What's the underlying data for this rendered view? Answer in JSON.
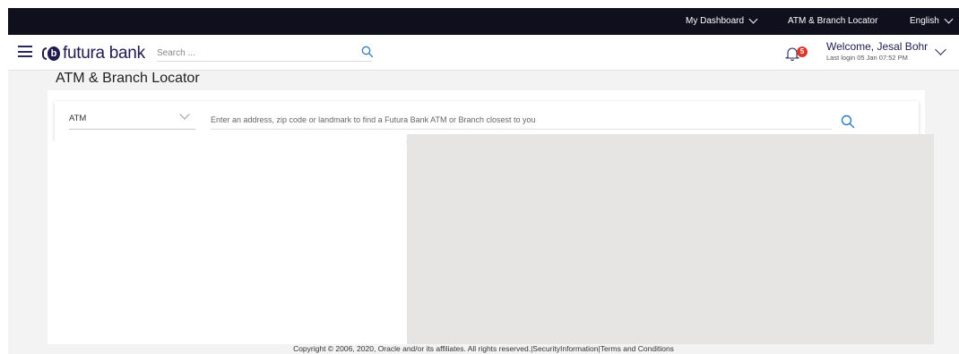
{
  "topbar": {
    "dashboard": "My Dashboard",
    "atm_branch": "ATM & Branch Locator",
    "language": "English"
  },
  "header": {
    "brand": "futura bank",
    "logo_letter": "b",
    "search_placeholder": "Search ...",
    "notification_count": "5",
    "welcome": "Welcome, Jesal Bohr",
    "last_login": "Last login 05 Jan 07:52 PM"
  },
  "page": {
    "title": "ATM & Branch Locator"
  },
  "locator": {
    "type_value": "ATM",
    "input_placeholder": "Enter an address, zip code or landmark to find a Futura Bank ATM or Branch closest to you"
  },
  "footer": {
    "text": "Copyright © 2006, 2020, Oracle and/or its affiliates. All rights reserved.|SecurityInformation|Terms and Conditions"
  },
  "colors": {
    "topbar_bg": "#0f0f1e",
    "brand": "#1f1b4f",
    "badge": "#d93a2f",
    "accent_icon": "#2f7bbf",
    "map_bg": "#e6e5e3"
  }
}
